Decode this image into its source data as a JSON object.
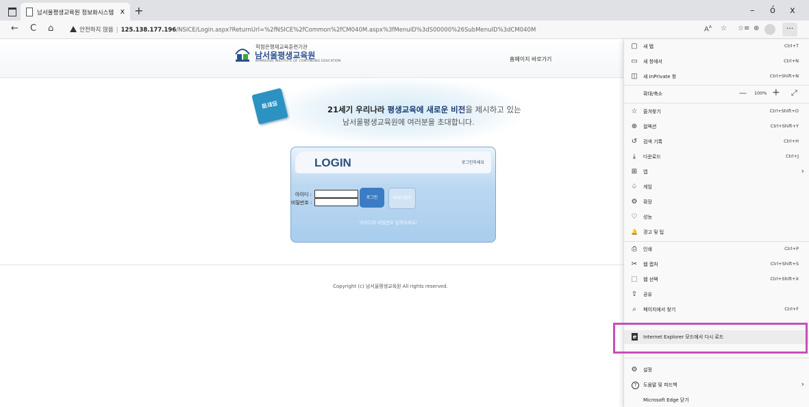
{
  "browser": {
    "tab_title": "남서울평생교육원 정보화시스템",
    "tab_close": "x",
    "new_tab": "+",
    "window_controls": {
      "minimize": "–",
      "maximize": "ó",
      "close": "x"
    },
    "nav": {
      "back": "←",
      "refresh": "C",
      "home": "⌂"
    },
    "address": {
      "warning_text": "안전하지 않음",
      "host": "125.138.177.196",
      "path": "/NSICE/Login.aspx?ReturnUrl=%2fNSICE%2fCommon%2fCM040M.aspx%3fMenuID%3dS00000%26SubMenuID%3dCM040M"
    },
    "toolbar_icons": [
      "read-aloud-icon",
      "favorite-add-icon",
      "favorites-icon",
      "collections-icon",
      "profile-icon",
      "more-icon"
    ],
    "more_label": "···"
  },
  "header": {
    "logo_top": "학점은행제교육훈련기관",
    "logo_main": "남서울평생교육원",
    "logo_sub": "NAMSEOUL INSTITUTE OF CONTINUING EDUCATION",
    "home_link": "홈페이지 바로가기"
  },
  "splash": {
    "badge_line1": "로그인",
    "badge_line2": "하세요",
    "slogan_a": "21세기 우리나라 ",
    "slogan_b": "평생교육에 새로운 비전",
    "slogan_c": "을 제시하고 있는",
    "slogan_line2": "남서울평생교육원에 여러분을 초대합니다."
  },
  "login": {
    "title": "LOGIN",
    "hint": "로그인하세요",
    "id_label": "아이디 :",
    "pw_label": "비밀번호 :",
    "id_value": "",
    "pw_value": "",
    "login_button": "로그인",
    "find_button": "아이디찾기",
    "message": "아이디와 비밀번호 입력하세요!"
  },
  "footer": {
    "copyright": "Copyright (c) 남서울평생교육원 All rights reserved."
  },
  "menu": {
    "items": [
      {
        "icon": "▢",
        "label": "새 탭",
        "shortcut": "Ctrl+T"
      },
      {
        "icon": "▭",
        "label": "새 창에서",
        "shortcut": "Ctrl+N"
      },
      {
        "icon": "◫",
        "label": "새 InPrivate 창",
        "shortcut": "Ctrl+Shift+N"
      },
      {
        "icon": "",
        "label": "확대/축소",
        "shortcut": ""
      },
      {
        "icon": "☆",
        "label": "즐겨찾기",
        "shortcut": "Ctrl+Shift+O"
      },
      {
        "icon": "⊕",
        "label": "컬렉션",
        "shortcut": "Ctrl+Shift+Y"
      },
      {
        "icon": "↺",
        "label": "검색 기록",
        "shortcut": "Ctrl+H"
      },
      {
        "icon": "⤓",
        "label": "다운로드",
        "shortcut": "Ctrl+J"
      },
      {
        "icon": "⊞",
        "label": "앱",
        "shortcut": ""
      },
      {
        "icon": "♤",
        "label": "게임",
        "shortcut": ""
      },
      {
        "icon": "⚙",
        "label": "확장",
        "shortcut": ""
      },
      {
        "icon": "♡",
        "label": "성능",
        "shortcut": ""
      },
      {
        "icon": "🔔",
        "label": "경고 및 팁",
        "shortcut": ""
      },
      {
        "icon": "⎙",
        "label": "인쇄",
        "shortcut": "Ctrl+P"
      },
      {
        "icon": "✂",
        "label": "웹 캡처",
        "shortcut": "Ctrl+Shift+S"
      },
      {
        "icon": "⬚",
        "label": "웹 선택",
        "shortcut": "Ctrl+Shift+X"
      },
      {
        "icon": "⇪",
        "label": "공유",
        "shortcut": ""
      },
      {
        "icon": "⌕",
        "label": "페이지에서 찾기",
        "shortcut": "Ctrl+F"
      },
      {
        "icon": "e",
        "label": "Internet Explorer 모드에서 다시 로드",
        "shortcut": ""
      },
      {
        "icon": "⚙",
        "label": "설정",
        "shortcut": ""
      },
      {
        "icon": "?",
        "label": "도움말 및 피드백",
        "shortcut": ""
      },
      {
        "icon": "",
        "label": "Microsoft Edge 닫기",
        "shortcut": ""
      }
    ],
    "zoom": {
      "minus": "—",
      "value": "100%",
      "plus": "+",
      "fullscreen": "⤢"
    },
    "submenu_arrow": "›"
  },
  "colors": {
    "highlight_border": "#c64fb6",
    "login_button": "#3b7cc5",
    "logo_blue": "#2c4f8c"
  }
}
